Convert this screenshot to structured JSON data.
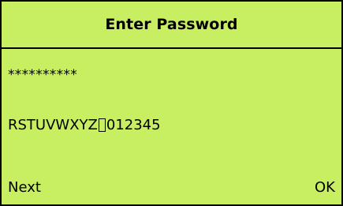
{
  "screen": {
    "title": "Enter Password",
    "masked_password": "**********",
    "charset_before_cursor": "RSTUVWXYZ",
    "charset_after_cursor": "012345",
    "softkeys": {
      "left": "Next",
      "right": "OK"
    }
  },
  "colors": {
    "display_background": "#c8ee62",
    "text": "#000000",
    "border": "#000000"
  }
}
